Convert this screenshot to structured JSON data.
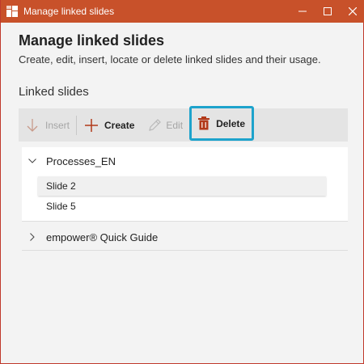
{
  "window": {
    "title": "Manage linked slides",
    "controls": [
      "minimize-icon",
      "maximize-icon",
      "close-icon"
    ]
  },
  "header": {
    "title": "Manage linked slides",
    "subtitle": "Create, edit, insert, locate or delete linked slides and their usage."
  },
  "section": {
    "title": "Linked slides"
  },
  "toolbar": {
    "insert_label": "Insert",
    "insert_icon": "arrow-down-icon",
    "insert_enabled": false,
    "create_label": "Create",
    "create_icon": "plus-icon",
    "create_enabled": true,
    "edit_label": "Edit",
    "edit_icon": "pencil-icon",
    "edit_enabled": false,
    "delete_label": "Delete",
    "delete_icon": "trash-icon",
    "delete_enabled": true,
    "delete_highlighted": true
  },
  "tree": {
    "groups": [
      {
        "label": "Processes_EN",
        "expanded": true,
        "items": [
          {
            "label": "Slide 2",
            "selected": true
          },
          {
            "label": "Slide 5",
            "selected": false
          }
        ]
      },
      {
        "label": "empower® Quick Guide",
        "expanded": false,
        "items": []
      }
    ]
  },
  "colors": {
    "titlebar": "#c8512a",
    "accent_icon": "#b23a1a",
    "highlight_border": "#1ea3cc",
    "disabled_text": "#a5a5a5"
  }
}
